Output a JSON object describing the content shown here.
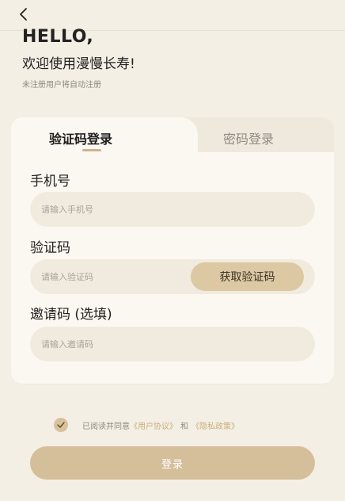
{
  "header": {
    "back_icon": "chevron-left-icon"
  },
  "greeting": {
    "hello": "HELLO,",
    "welcome": "欢迎使用漫慢长寿!",
    "note": "未注册用户将自动注册"
  },
  "tabs": [
    {
      "label": "验证码登录",
      "active": true
    },
    {
      "label": "密码登录",
      "active": false
    }
  ],
  "form": {
    "phone": {
      "label": "手机号",
      "placeholder": "请输入手机号",
      "value": ""
    },
    "code": {
      "label": "验证码",
      "placeholder": "请输入验证码",
      "value": "",
      "get_code_button": "获取验证码"
    },
    "invite": {
      "label": "邀请码 (选填)",
      "placeholder": "请输入邀请码",
      "value": ""
    }
  },
  "agreement": {
    "checked": true,
    "prefix": "已阅读并同意",
    "user_agreement": "《用户协议》",
    "and": "和",
    "privacy_policy": "《隐私政策》"
  },
  "login_button": "登录",
  "colors": {
    "background": "#f4efe4",
    "accent": "#d4bf9a",
    "link": "#c9ad7f",
    "input_bg": "#f1ebdf"
  }
}
